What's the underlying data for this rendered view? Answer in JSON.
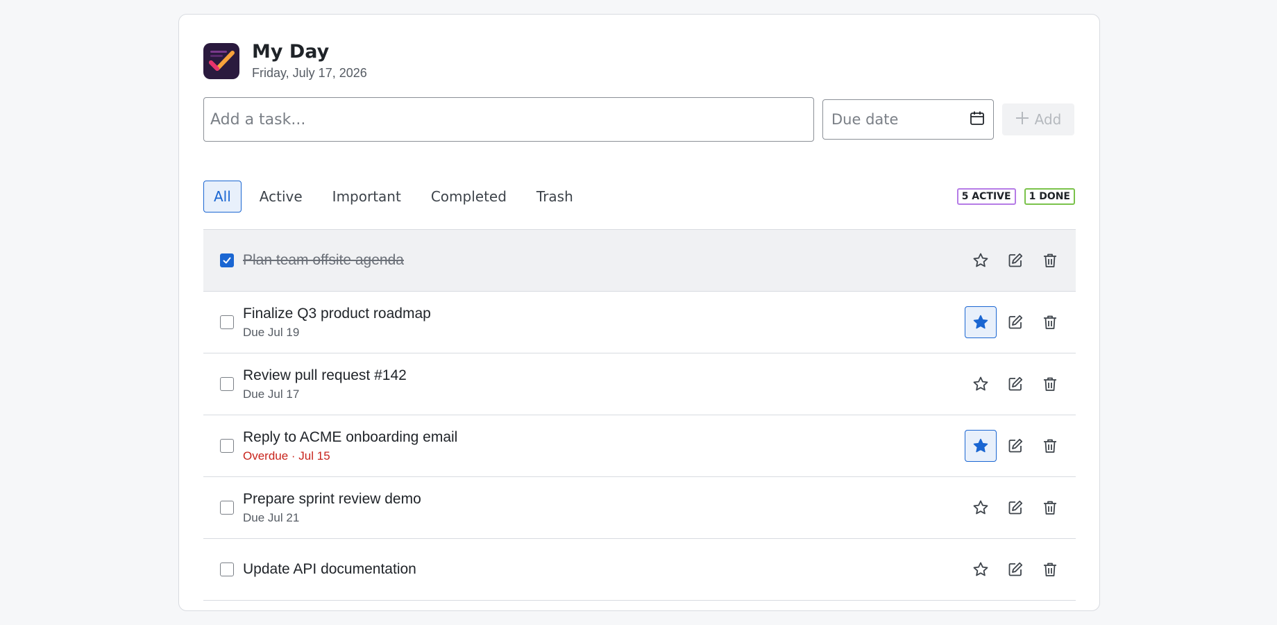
{
  "header": {
    "title": "My Day",
    "date": "Friday, July 17, 2026"
  },
  "add_form": {
    "task_placeholder": "Add a task...",
    "due_placeholder": "Due date",
    "add_label": "Add"
  },
  "filters": {
    "tabs": [
      "All",
      "Active",
      "Important",
      "Completed",
      "Trash"
    ],
    "selected": "All"
  },
  "stats": {
    "active": "5 ACTIVE",
    "done": "1 DONE"
  },
  "tasks": [
    {
      "title": "Plan team offsite agenda",
      "due": "",
      "completed": true,
      "important": false
    },
    {
      "title": "Finalize Q3 product roadmap",
      "due": "Due Jul 19",
      "completed": false,
      "important": true
    },
    {
      "title": "Review pull request #142",
      "due": "Due Jul 17",
      "completed": false,
      "important": false
    },
    {
      "title": "Reply to ACME onboarding email",
      "due": "Overdue · Jul 15",
      "completed": false,
      "important": true,
      "overdue": true
    },
    {
      "title": "Prepare sprint review demo",
      "due": "Due Jul 21",
      "completed": false,
      "important": false
    },
    {
      "title": "Update API documentation",
      "due": "",
      "completed": false,
      "important": false
    }
  ],
  "colors": {
    "accent": "#1a66d2",
    "overdue": "#c8241c",
    "active_badge": "#b57be6",
    "done_badge": "#7ac24a"
  }
}
